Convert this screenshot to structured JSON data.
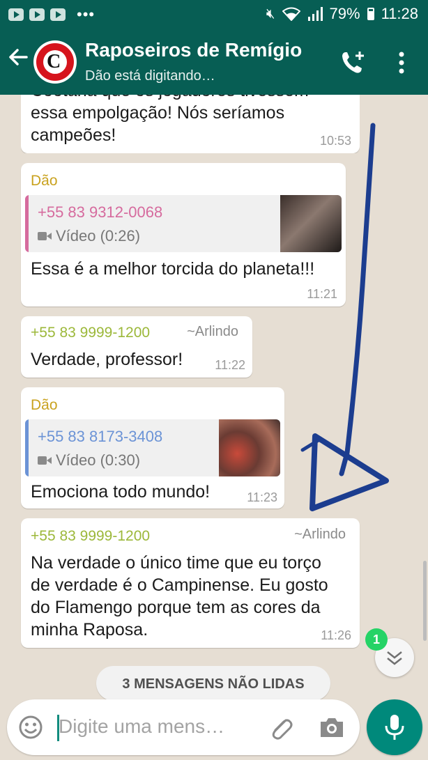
{
  "status_bar": {
    "battery": "79%",
    "time": "11:28"
  },
  "header": {
    "title": "Raposeiros de Remígio",
    "subtitle": "Dão está digitando…",
    "avatar_letter": "C"
  },
  "messages": [
    {
      "lines": [
        "Cootana que os jogadores tivessem",
        "essa empolgação! Nós seríamos",
        "campeões!"
      ],
      "time": "10:53"
    },
    {
      "sender": "Dão",
      "quote": {
        "name": "+55 83 9312-0068",
        "type": "Vídeo (0:26)"
      },
      "lines": [
        "Essa é a melhor torcida do planeta!!!"
      ],
      "time": "11:21"
    },
    {
      "sender": "+55 83 9999-1200",
      "alias": "~Arlindo",
      "lines": [
        "Verdade, professor!"
      ],
      "time": "11:22"
    },
    {
      "sender": "Dão",
      "quote": {
        "name": "+55 83 8173-3408",
        "type": "Vídeo (0:30)"
      },
      "lines": [
        "Emociona todo mundo!"
      ],
      "time": "11:23"
    },
    {
      "sender": "+55 83 9999-1200",
      "alias": "~Arlindo",
      "lines": [
        "Na verdade o único time que eu torço",
        "de verdade é o Campinense. Eu gosto",
        "do Flamengo porque tem as cores da",
        "minha Raposa."
      ],
      "time": "11:26"
    }
  ],
  "unread_label": "3 MENSAGENS NÃO LIDAS",
  "unread_badge": "1",
  "composer": {
    "placeholder": "Digite uma mens…"
  },
  "icons": {
    "back": "arrow-left-icon",
    "call": "add-call-icon",
    "menu": "more-vert-icon",
    "emoji": "emoji-icon",
    "attach": "paperclip-icon",
    "camera": "camera-icon",
    "mic": "mic-icon",
    "scroll": "chevron-double-down-icon"
  },
  "colors": {
    "header": "#075e54",
    "sender_dao": "#c9a21f",
    "sender_number": "#9cb83a",
    "quote_pink": "#d66b9e",
    "quote_blue": "#6b93d6",
    "arrow": "#1c3d8f",
    "mic_button": "#00897b"
  }
}
